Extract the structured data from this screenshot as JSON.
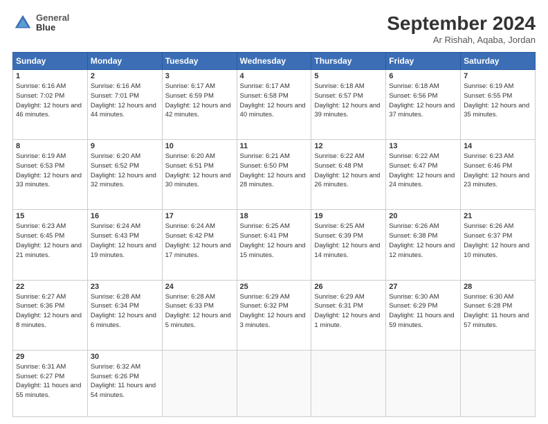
{
  "header": {
    "logo_line1": "General",
    "logo_line2": "Blue",
    "month": "September 2024",
    "location": "Ar Rishah, Aqaba, Jordan"
  },
  "weekdays": [
    "Sunday",
    "Monday",
    "Tuesday",
    "Wednesday",
    "Thursday",
    "Friday",
    "Saturday"
  ],
  "weeks": [
    [
      {
        "day": "1",
        "sunrise": "6:16 AM",
        "sunset": "7:02 PM",
        "daylight": "12 hours and 46 minutes."
      },
      {
        "day": "2",
        "sunrise": "6:16 AM",
        "sunset": "7:01 PM",
        "daylight": "12 hours and 44 minutes."
      },
      {
        "day": "3",
        "sunrise": "6:17 AM",
        "sunset": "6:59 PM",
        "daylight": "12 hours and 42 minutes."
      },
      {
        "day": "4",
        "sunrise": "6:17 AM",
        "sunset": "6:58 PM",
        "daylight": "12 hours and 40 minutes."
      },
      {
        "day": "5",
        "sunrise": "6:18 AM",
        "sunset": "6:57 PM",
        "daylight": "12 hours and 39 minutes."
      },
      {
        "day": "6",
        "sunrise": "6:18 AM",
        "sunset": "6:56 PM",
        "daylight": "12 hours and 37 minutes."
      },
      {
        "day": "7",
        "sunrise": "6:19 AM",
        "sunset": "6:55 PM",
        "daylight": "12 hours and 35 minutes."
      }
    ],
    [
      {
        "day": "8",
        "sunrise": "6:19 AM",
        "sunset": "6:53 PM",
        "daylight": "12 hours and 33 minutes."
      },
      {
        "day": "9",
        "sunrise": "6:20 AM",
        "sunset": "6:52 PM",
        "daylight": "12 hours and 32 minutes."
      },
      {
        "day": "10",
        "sunrise": "6:20 AM",
        "sunset": "6:51 PM",
        "daylight": "12 hours and 30 minutes."
      },
      {
        "day": "11",
        "sunrise": "6:21 AM",
        "sunset": "6:50 PM",
        "daylight": "12 hours and 28 minutes."
      },
      {
        "day": "12",
        "sunrise": "6:22 AM",
        "sunset": "6:48 PM",
        "daylight": "12 hours and 26 minutes."
      },
      {
        "day": "13",
        "sunrise": "6:22 AM",
        "sunset": "6:47 PM",
        "daylight": "12 hours and 24 minutes."
      },
      {
        "day": "14",
        "sunrise": "6:23 AM",
        "sunset": "6:46 PM",
        "daylight": "12 hours and 23 minutes."
      }
    ],
    [
      {
        "day": "15",
        "sunrise": "6:23 AM",
        "sunset": "6:45 PM",
        "daylight": "12 hours and 21 minutes."
      },
      {
        "day": "16",
        "sunrise": "6:24 AM",
        "sunset": "6:43 PM",
        "daylight": "12 hours and 19 minutes."
      },
      {
        "day": "17",
        "sunrise": "6:24 AM",
        "sunset": "6:42 PM",
        "daylight": "12 hours and 17 minutes."
      },
      {
        "day": "18",
        "sunrise": "6:25 AM",
        "sunset": "6:41 PM",
        "daylight": "12 hours and 15 minutes."
      },
      {
        "day": "19",
        "sunrise": "6:25 AM",
        "sunset": "6:39 PM",
        "daylight": "12 hours and 14 minutes."
      },
      {
        "day": "20",
        "sunrise": "6:26 AM",
        "sunset": "6:38 PM",
        "daylight": "12 hours and 12 minutes."
      },
      {
        "day": "21",
        "sunrise": "6:26 AM",
        "sunset": "6:37 PM",
        "daylight": "12 hours and 10 minutes."
      }
    ],
    [
      {
        "day": "22",
        "sunrise": "6:27 AM",
        "sunset": "6:36 PM",
        "daylight": "12 hours and 8 minutes."
      },
      {
        "day": "23",
        "sunrise": "6:28 AM",
        "sunset": "6:34 PM",
        "daylight": "12 hours and 6 minutes."
      },
      {
        "day": "24",
        "sunrise": "6:28 AM",
        "sunset": "6:33 PM",
        "daylight": "12 hours and 5 minutes."
      },
      {
        "day": "25",
        "sunrise": "6:29 AM",
        "sunset": "6:32 PM",
        "daylight": "12 hours and 3 minutes."
      },
      {
        "day": "26",
        "sunrise": "6:29 AM",
        "sunset": "6:31 PM",
        "daylight": "12 hours and 1 minute."
      },
      {
        "day": "27",
        "sunrise": "6:30 AM",
        "sunset": "6:29 PM",
        "daylight": "11 hours and 59 minutes."
      },
      {
        "day": "28",
        "sunrise": "6:30 AM",
        "sunset": "6:28 PM",
        "daylight": "11 hours and 57 minutes."
      }
    ],
    [
      {
        "day": "29",
        "sunrise": "6:31 AM",
        "sunset": "6:27 PM",
        "daylight": "11 hours and 55 minutes."
      },
      {
        "day": "30",
        "sunrise": "6:32 AM",
        "sunset": "6:26 PM",
        "daylight": "11 hours and 54 minutes."
      },
      null,
      null,
      null,
      null,
      null
    ]
  ]
}
